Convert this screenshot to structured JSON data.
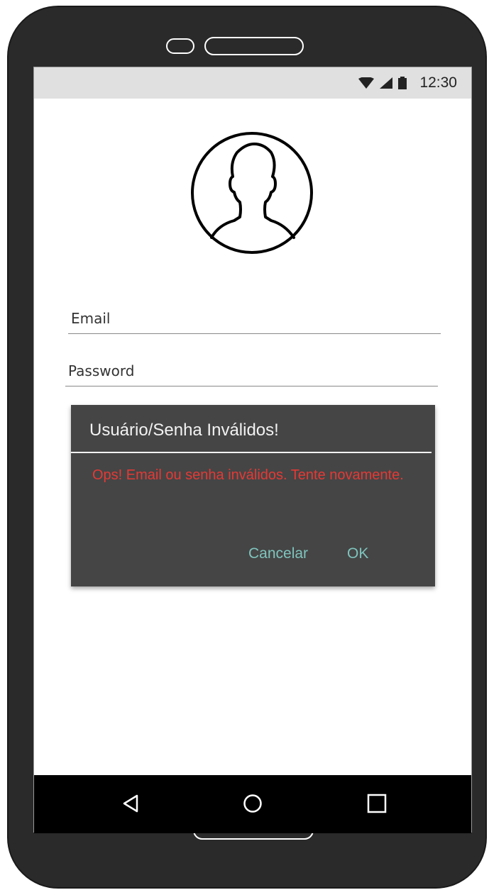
{
  "status_bar": {
    "time": "12:30",
    "icons": [
      "wifi-icon",
      "signal-icon",
      "battery-icon"
    ]
  },
  "avatar": {
    "icon": "user-silhouette-icon"
  },
  "form": {
    "email_placeholder": "Email",
    "password_placeholder": "Password"
  },
  "dialog": {
    "title": "Usuário/Senha Inválidos!",
    "message": "Ops! Email ou senha inválidos. Tente novamente.",
    "cancel_label": "Cancelar",
    "ok_label": "OK",
    "message_color": "#e53935",
    "action_color": "#7fc4bd"
  },
  "nav_bar": {
    "icons": [
      "back-icon",
      "home-icon",
      "recents-icon"
    ]
  }
}
